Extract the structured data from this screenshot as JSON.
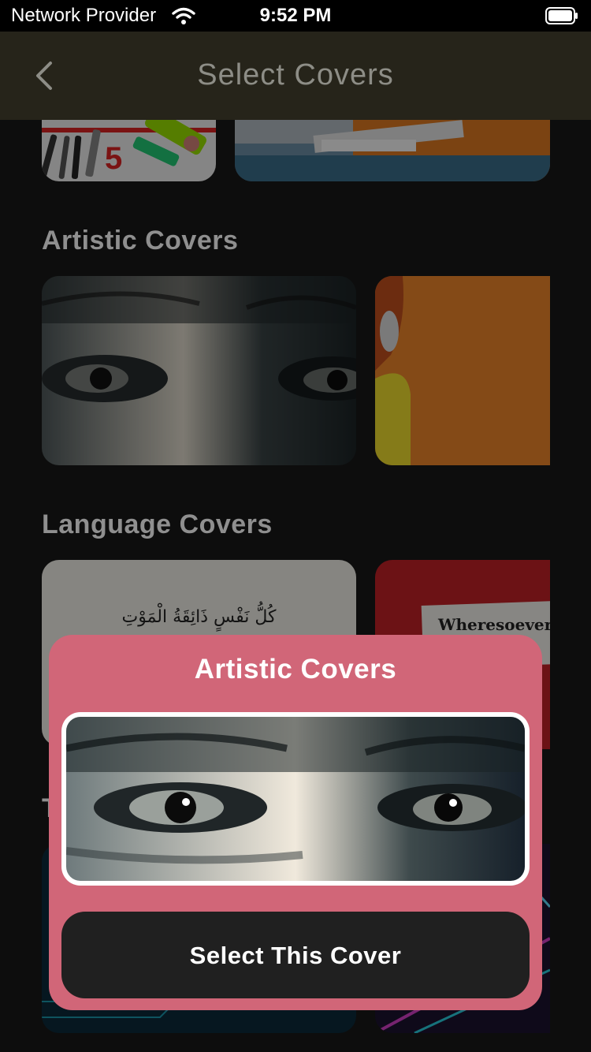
{
  "status_bar": {
    "carrier": "Network Provider",
    "time": "9:52 PM",
    "icons": [
      "wifi-icon",
      "battery-icon"
    ]
  },
  "nav": {
    "title": "Select Covers",
    "back_icon": "chevron-left-icon"
  },
  "sections": [
    {
      "title": "Artistic Covers"
    },
    {
      "title": "Language Covers"
    },
    {
      "title": "T"
    }
  ],
  "language_cards": {
    "arabic_text": "كُلُّ نَفْسٍ ذَائِقَةُ الْمَوْتِ",
    "quote_text": "Wheresoever"
  },
  "modal": {
    "title": "Artistic Covers",
    "button_label": "Select This Cover"
  },
  "colors": {
    "background": "#0d0d0d",
    "navbar": "#26241a",
    "modal": "#d16678",
    "button": "#202020"
  }
}
